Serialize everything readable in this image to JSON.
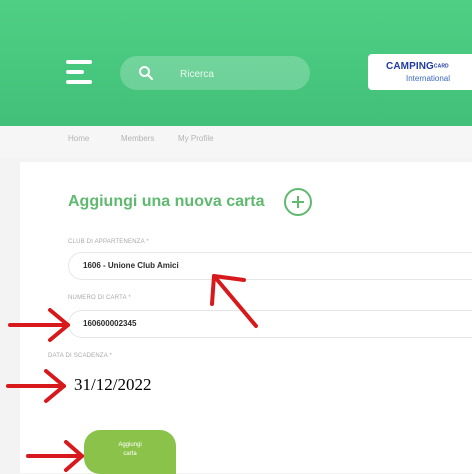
{
  "header": {
    "search": {
      "placeholder": "Ricerca"
    },
    "logo": {
      "main": "CAMPING",
      "small": "CARD",
      "sub": "International"
    }
  },
  "nav": {
    "items": [
      {
        "label": "Home"
      },
      {
        "label": "Members"
      },
      {
        "label": "My Profile"
      }
    ]
  },
  "form": {
    "title": "Aggiungi una nuova carta",
    "club": {
      "label": "CLUB DI APPARTENENZA *",
      "value": "1606 - Unione Club Amici"
    },
    "card_number": {
      "label": "NUMERO DI CARTA *",
      "value": "160600002345"
    },
    "expiry": {
      "label": "DATA DI SCADENZA *",
      "value": "31/12/2022"
    },
    "submit_label": "Aggiungi\ncarta"
  },
  "colors": {
    "header_green": "#4fcf84",
    "accent_green": "#5fba6f",
    "button_green": "#8bc34a",
    "annotation_red": "#d7191c"
  }
}
